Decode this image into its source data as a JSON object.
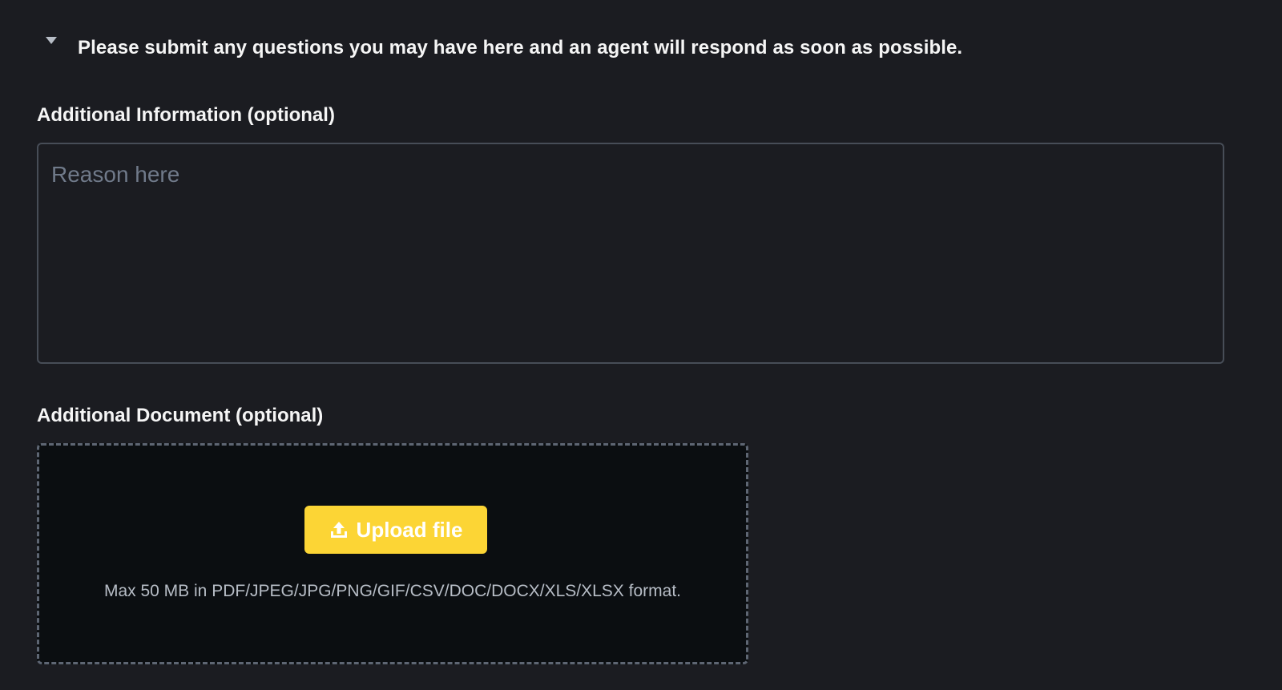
{
  "notice": {
    "icon": "caret-down-icon",
    "text": "Please submit any questions you may have here and an agent will respond as soon as possible."
  },
  "additional_info": {
    "label": "Additional Information (optional)",
    "placeholder": "Reason here",
    "value": ""
  },
  "additional_document": {
    "label": "Additional Document (optional)",
    "upload_icon": "upload-icon",
    "upload_button_label": "Upload file",
    "hint": "Max 50 MB in PDF/JPEG/JPG/PNG/GIF/CSV/DOC/DOCX/XLS/XLSX format."
  },
  "colors": {
    "background": "#1b1c21",
    "dropzone_background": "#0b0e11",
    "accent": "#fcd535",
    "border": "#474d57",
    "text_primary": "#f5f5f5",
    "text_secondary": "#b7bdc6",
    "placeholder": "#707a8a"
  }
}
